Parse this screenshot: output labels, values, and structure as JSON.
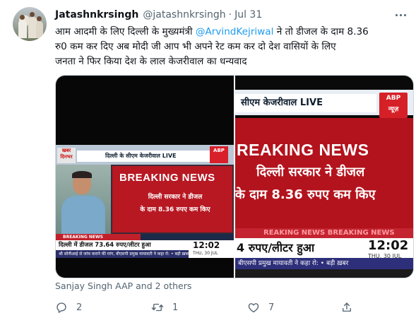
{
  "tweet": {
    "display_name": "Jatashnkrsingh",
    "handle": "@jatashnkrsingh",
    "separator": "·",
    "date": "Jul 31",
    "text": {
      "line1_before_mention": "आम आदमी के लिए दिल्ली के मुख्यमंत्री ",
      "mention": "@ArvindKejriwal",
      "line1_after_mention": " ने तो डीजल के दाम 8.36",
      "line2": "रु0 कम कर दिए अब मोदी जी आप भी अपने रेट कम कर दो देश वासियों के लिए",
      "line3": "जनता ने फिर किया देश के लाल केजरीवाल का धन्यवाद"
    },
    "liked_by": "Sanjay Singh AAP and 2 others",
    "actions": {
      "reply_count": "2",
      "retweet_count": "1",
      "like_count": "7"
    }
  },
  "media": {
    "left_image": {
      "channel_logo": "खबर दिनभर",
      "live_strip": "दिल्ली के सीएम केजरीवाल LIVE",
      "breaking_news": "BREAKING NEWS",
      "headline_line1": "दिल्ली सरकार ने डीजल",
      "headline_line2": "के दाम 8.36 रुपए कम किए",
      "bn_strip": "BREAKING NEWS",
      "diesel_price": "दिल्ली में डीजल 73.64 रुपए/लीटर हुआ",
      "time": "12:02",
      "date": "THU, 30 JUL",
      "ticker": "श्री सोनीआई से जांच कराने की मांग, बीएसपी प्रमुख मायावती ने कहा रो: • बड़ी ख़बर",
      "abp_logo": "ABP"
    },
    "right_image": {
      "live_strip": "सीएम केजरीवाल LIVE",
      "abp_logo_line1": "ABP",
      "abp_logo_line2": "न्यूज़",
      "breaking_news": "REAKING NEWS",
      "headline_line1": "दिल्ली सरकार ने डीजल",
      "headline_line2": "के दाम 8.36 रुपए कम किए",
      "bn_strip": "REAKING NEWS   BREAKING NEWS",
      "diesel_price": "4 रुपए/लीटर हुआ",
      "time": "12:02",
      "date": "THU, 30 JUL",
      "ticker": "बीएसपी प्रमुख मायावती ने कहा रो: • बड़ी ख़बर"
    }
  },
  "colors": {
    "mention": "#1d9bf0",
    "secondary_text": "#536471",
    "breaking_red": "#b3131d"
  },
  "icons": [
    "more-icon",
    "reply-icon",
    "retweet-icon",
    "like-icon",
    "share-icon"
  ]
}
